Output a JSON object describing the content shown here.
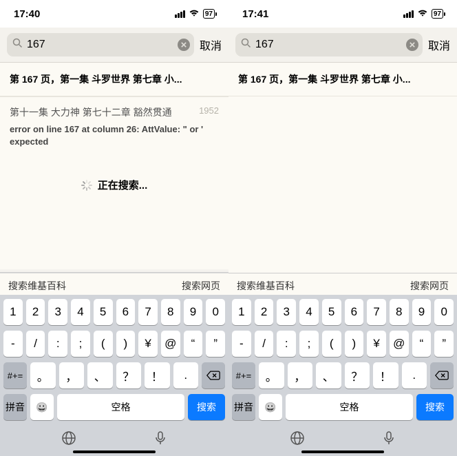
{
  "left": {
    "status": {
      "time": "17:40",
      "battery": "97"
    },
    "search": {
      "query": "167",
      "cancel": "取消"
    },
    "result1": "第 167 页，第一集 斗罗世界 第七章 小...",
    "result2": {
      "title": "第十一集 大力神 第七十二章 豁然贯通",
      "num": "1952"
    },
    "error_pre": "error on line ",
    "error_num": "167",
    "error_post": " at column 26: AttValue: \" or ' expected",
    "loading": "正在搜索...",
    "toolbar": {
      "wiki": "搜索维基百科",
      "web": "搜索网页"
    }
  },
  "right": {
    "status": {
      "time": "17:41",
      "battery": "97"
    },
    "search": {
      "query": "167",
      "cancel": "取消"
    },
    "result1": "第 167 页，第一集 斗罗世界 第七章 小...",
    "toolbar": {
      "wiki": "搜索维基百科",
      "web": "搜索网页"
    }
  },
  "kbd": {
    "row1": [
      "1",
      "2",
      "3",
      "4",
      "5",
      "6",
      "7",
      "8",
      "9",
      "0"
    ],
    "row2": [
      "-",
      "/",
      ":",
      ";",
      "(",
      ")",
      "¥",
      "@",
      "“",
      "”"
    ],
    "row3": {
      "shift": "#+=",
      "keys": [
        "。",
        "，",
        "、",
        "？",
        "！",
        "."
      ],
      "del": ""
    },
    "row4": {
      "pinyin": "拼音",
      "space": "空格",
      "search": "搜索"
    }
  }
}
